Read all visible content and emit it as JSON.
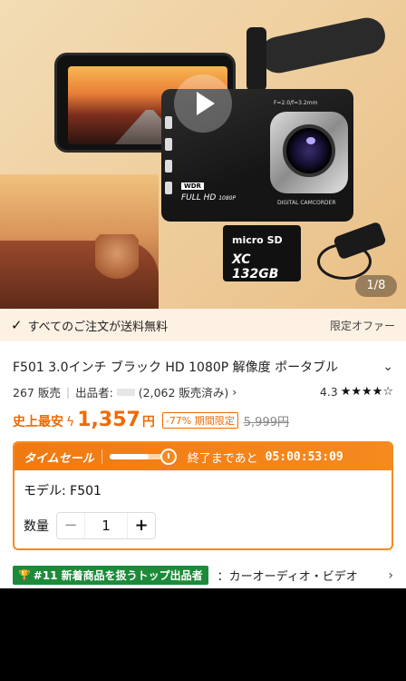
{
  "hero": {
    "counter": "1/8",
    "camera": {
      "wdr_label": "WDR",
      "fullhd_label": "FULL HD",
      "resolution_label": "1080P",
      "lens_label": "DIGITAL CAMCORDER",
      "aperture_label": "F=2.0/f=3.2mm"
    },
    "sdcard": {
      "brand": "micro SD",
      "capacity": "XC 132GB"
    }
  },
  "shipping": {
    "message": "すべてのご注文が送料無料",
    "offer": "限定オファー"
  },
  "product": {
    "title": "F501 3.0インチ ブラック HD 1080P 解像度 ポータブル",
    "sold": "267 販売",
    "seller_label": "出品者:",
    "seller_sales": "(2,062 販売済み)",
    "rating": "4.3",
    "stars": "★★★★☆",
    "low_tag": "史上最安",
    "price": "1,357",
    "yen": "円",
    "discount": "-77% 期間限定",
    "original_price": "5,999円"
  },
  "sale": {
    "label": "タイムセール",
    "progress": 0.7,
    "ends_label": "終了まであと",
    "timer": "05:00:53:09",
    "model_label": "モデル: F501",
    "qty_label": "数量",
    "qty_value": "1"
  },
  "rank": {
    "badge": "#11 新着商品を扱うトップ出品者",
    "category": "：カーオーディオ・ビデオ"
  }
}
